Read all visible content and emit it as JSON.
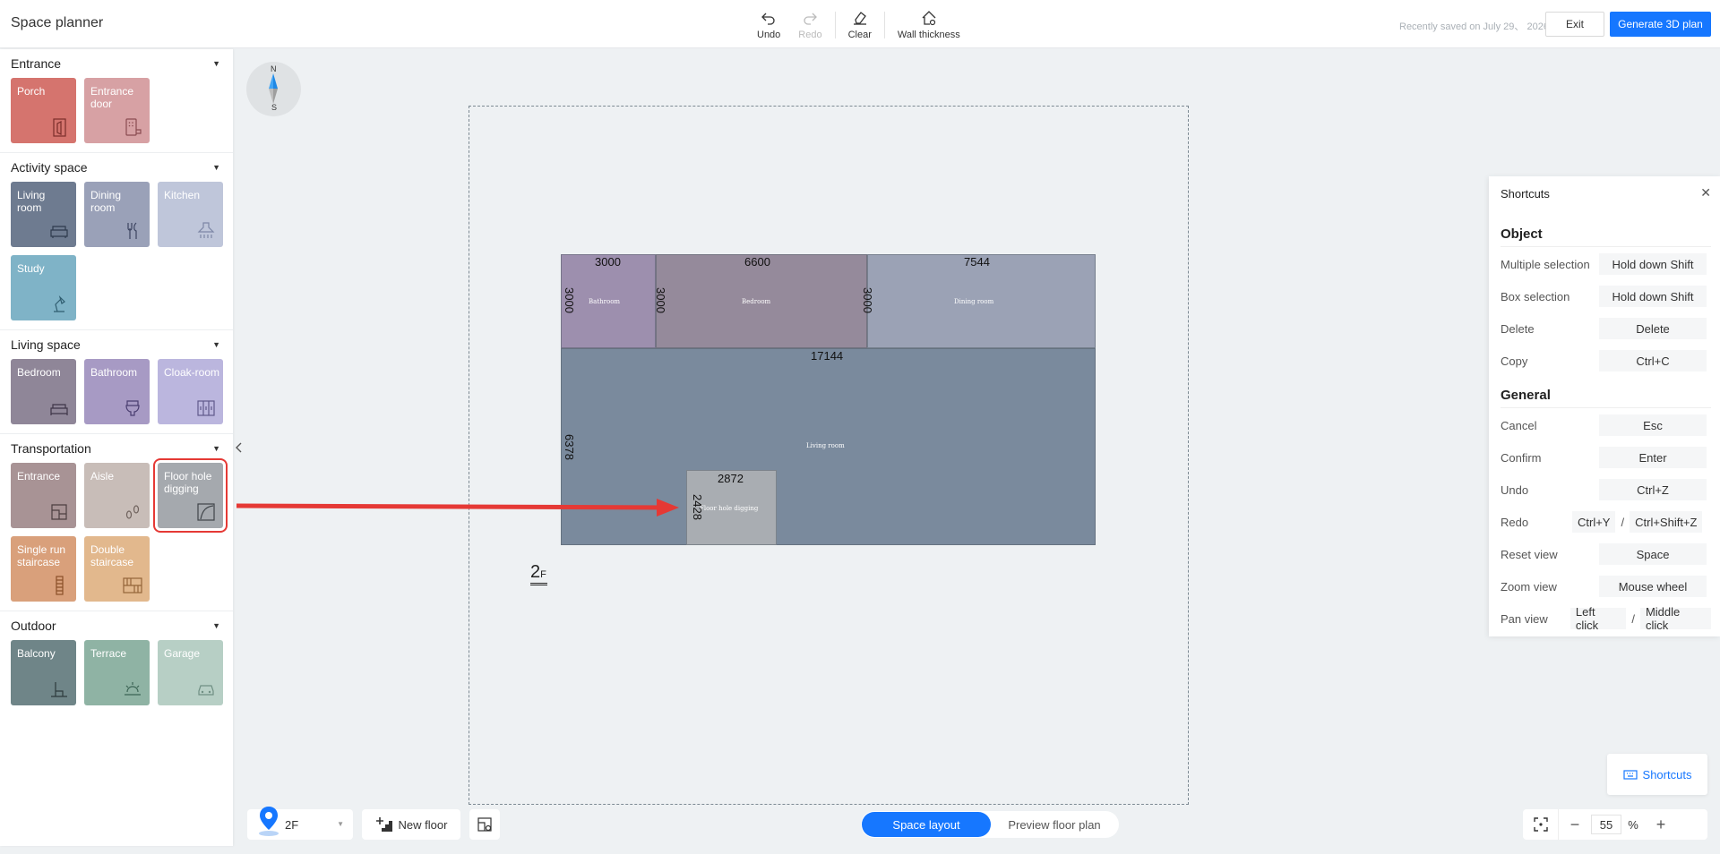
{
  "header": {
    "title": "Space planner",
    "undo": "Undo",
    "redo": "Redo",
    "clear": "Clear",
    "wall_thickness": "Wall thickness",
    "saved_status": "Recently saved on July 29、 2026",
    "exit": "Exit",
    "generate": "Generate 3D plan"
  },
  "sidebar": {
    "sections": [
      {
        "title": "Entrance",
        "items": [
          {
            "label": "Porch",
            "icon": "door-icon",
            "color": "#d5746e"
          },
          {
            "label": "Entrance door",
            "icon": "keypad-door-icon",
            "color": "#d7a1a4"
          }
        ]
      },
      {
        "title": "Activity space",
        "items": [
          {
            "label": "Living room",
            "icon": "sofa-icon",
            "color": "#6e7b90"
          },
          {
            "label": "Dining room",
            "icon": "cutlery-icon",
            "color": "#9aa1b8"
          },
          {
            "label": "Kitchen",
            "icon": "range-hood-icon",
            "color": "#bfc6da"
          },
          {
            "label": "Study",
            "icon": "desk-lamp-icon",
            "color": "#7fb3c7"
          }
        ]
      },
      {
        "title": "Living space",
        "items": [
          {
            "label": "Bedroom",
            "icon": "bed-icon",
            "color": "#8f8698"
          },
          {
            "label": "Bathroom",
            "icon": "toilet-icon",
            "color": "#a79ac4"
          },
          {
            "label": "Cloak-room",
            "icon": "wardrobe-icon",
            "color": "#bbb6de"
          }
        ]
      },
      {
        "title": "Transportation",
        "items": [
          {
            "label": "Entrance",
            "icon": "entrance-icon",
            "color": "#a89395"
          },
          {
            "label": "Aisle",
            "icon": "footsteps-icon",
            "color": "#c8bdb8"
          },
          {
            "label": "Floor hole digging",
            "icon": "floor-hole-icon",
            "color": "#a5a9ae"
          },
          {
            "label": "Single run staircase",
            "icon": "single-stair-icon",
            "color": "#d9a07b"
          },
          {
            "label": "Double staircase",
            "icon": "double-stair-icon",
            "color": "#e2b88d"
          }
        ]
      },
      {
        "title": "Outdoor",
        "items": [
          {
            "label": "Balcony",
            "icon": "balcony-icon",
            "color": "#6f8588"
          },
          {
            "label": "Terrace",
            "icon": "sun-icon",
            "color": "#8fb3a4"
          },
          {
            "label": "Garage",
            "icon": "car-icon",
            "color": "#b7cfc5"
          }
        ]
      }
    ]
  },
  "compass": {
    "north": "N",
    "south": "S"
  },
  "plan": {
    "rooms": [
      {
        "name": "Bathroom",
        "width": "3000",
        "depth": "3000",
        "color": "#9d8fae"
      },
      {
        "name": "Bedroom",
        "width": "6600",
        "depth": "3000",
        "color": "#958a9b"
      },
      {
        "name": "Dining room",
        "width": "7544",
        "depth": "3000",
        "color": "#9ba2b5"
      },
      {
        "name": "Living room",
        "width": "17144",
        "depth": "6378",
        "color": "#7a8a9d"
      },
      {
        "name": "Floor hole digging",
        "width": "2872",
        "depth": "2428",
        "color": "#a9adb2"
      }
    ],
    "floor_tag": "2",
    "floor_tag_suffix": "F"
  },
  "shortcuts": {
    "title": "Shortcuts",
    "object_title": "Object",
    "general_title": "General",
    "object": [
      {
        "label": "Multiple selection",
        "keys": [
          "Hold down Shift"
        ]
      },
      {
        "label": "Box selection",
        "keys": [
          "Hold down Shift"
        ]
      },
      {
        "label": "Delete",
        "keys": [
          "Delete"
        ]
      },
      {
        "label": "Copy",
        "keys": [
          "Ctrl+C"
        ]
      }
    ],
    "general": [
      {
        "label": "Cancel",
        "keys": [
          "Esc"
        ]
      },
      {
        "label": "Confirm",
        "keys": [
          "Enter"
        ]
      },
      {
        "label": "Undo",
        "keys": [
          "Ctrl+Z"
        ]
      },
      {
        "label": "Redo",
        "keys": [
          "Ctrl+Y",
          "Ctrl+Shift+Z"
        ]
      },
      {
        "label": "Reset view",
        "keys": [
          "Space"
        ]
      },
      {
        "label": "Zoom view",
        "keys": [
          "Mouse wheel"
        ]
      },
      {
        "label": "Pan view",
        "keys": [
          "Left click",
          "Middle click"
        ]
      }
    ],
    "toggle_button": "Shortcuts"
  },
  "bottom": {
    "floor": "2F",
    "new_floor": "New floor",
    "mode_active": "Space layout",
    "mode_inactive": "Preview floor plan",
    "zoom_value": "55",
    "zoom_unit": "%"
  },
  "colors": {
    "accent": "#1677ff",
    "highlight": "#e53935"
  }
}
